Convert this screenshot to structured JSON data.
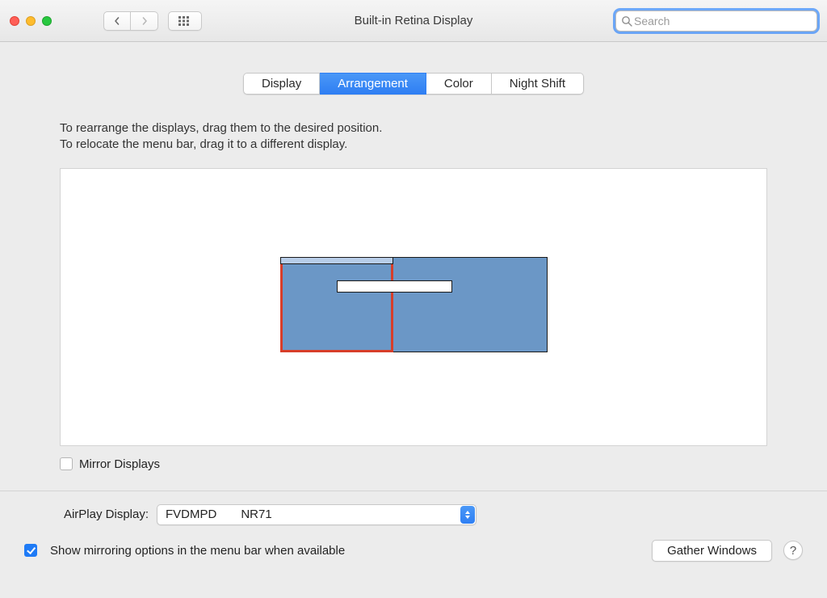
{
  "window": {
    "title": "Built-in Retina Display"
  },
  "search": {
    "placeholder": "Search"
  },
  "tabs": [
    {
      "label": "Display"
    },
    {
      "label": "Arrangement",
      "active": true
    },
    {
      "label": "Color"
    },
    {
      "label": "Night Shift"
    }
  ],
  "instructions": {
    "line1": "To rearrange the displays, drag them to the desired position.",
    "line2": "To relocate the menu bar, drag it to a different display."
  },
  "mirror": {
    "label": "Mirror Displays",
    "checked": false
  },
  "airplay": {
    "label": "AirPlay Display:",
    "value": "FVDMPD  NR71"
  },
  "show_mirroring": {
    "label": "Show mirroring options in the menu bar when available",
    "checked": true
  },
  "gather_button": "Gather Windows",
  "help_label": "?"
}
